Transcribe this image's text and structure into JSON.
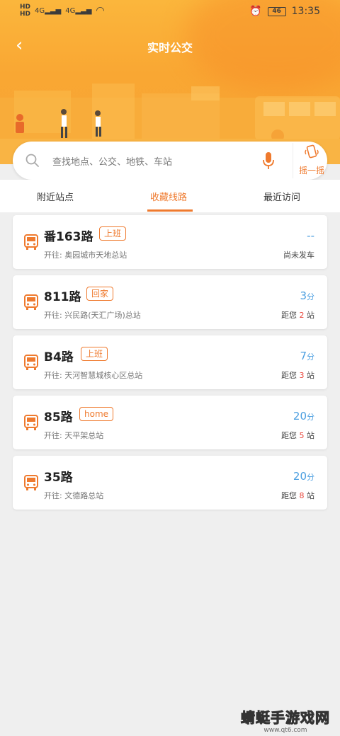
{
  "status_bar": {
    "signal_label_1": "4G",
    "signal_label_2": "4G",
    "battery": "46",
    "time": "13:35"
  },
  "nav": {
    "title": "实时公交"
  },
  "search": {
    "placeholder": "查找地点、公交、地铁、车站",
    "shake_label": "摇一摇"
  },
  "tabs": [
    {
      "label": "附近站点",
      "active": false
    },
    {
      "label": "收藏线路",
      "active": true
    },
    {
      "label": "最近访问",
      "active": false
    }
  ],
  "routes": [
    {
      "name": "番163路",
      "tag": "上班",
      "destination": "开往: 奥园城市天地总站",
      "eta": "--",
      "eta_unit": "",
      "status": "尚未发车",
      "stops_prefix": "",
      "stops_num": "",
      "stops_suffix": ""
    },
    {
      "name": "811路",
      "tag": "回家",
      "destination": "开往: 兴民路(天汇广场)总站",
      "eta": "3",
      "eta_unit": "分",
      "status": "",
      "stops_prefix": "距您 ",
      "stops_num": "2",
      "stops_suffix": " 站"
    },
    {
      "name": "B4路",
      "tag": "上班",
      "destination": "开往: 天河智慧城核心区总站",
      "eta": "7",
      "eta_unit": "分",
      "status": "",
      "stops_prefix": "距您 ",
      "stops_num": "3",
      "stops_suffix": " 站"
    },
    {
      "name": "85路",
      "tag": "home",
      "destination": "开往: 天平架总站",
      "eta": "20",
      "eta_unit": "分",
      "status": "",
      "stops_prefix": "距您 ",
      "stops_num": "5",
      "stops_suffix": " 站"
    },
    {
      "name": "35路",
      "tag": "",
      "destination": "开往: 文德路总站",
      "eta": "20",
      "eta_unit": "分",
      "status": "",
      "stops_prefix": "距您 ",
      "stops_num": "8",
      "stops_suffix": " 站"
    }
  ],
  "watermark": {
    "title": "蜻蜓手游戏网",
    "url": "www.qt6.com"
  },
  "colors": {
    "accent": "#ef7a2e",
    "eta_blue": "#4a9ee0",
    "stop_red": "#e8463c",
    "header": "#f9a733"
  }
}
